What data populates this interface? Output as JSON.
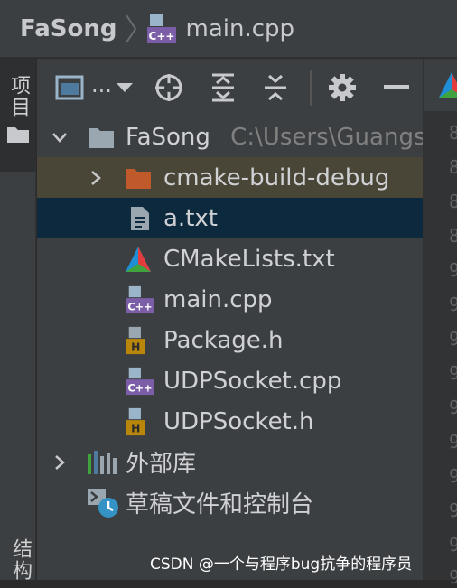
{
  "breadcrumb": {
    "project": "FaSong",
    "file": "main.cpp"
  },
  "sidebar": {
    "project_tab": "项目",
    "structure_tab": "结构"
  },
  "toolbar": {
    "view_label": "...",
    "icons": [
      "panel-view-icon",
      "dropdown-arrow-icon",
      "locate-icon",
      "expand-all-icon",
      "collapse-all-icon",
      "gear-icon",
      "minimize-icon"
    ]
  },
  "tree": {
    "root": {
      "name": "FaSong",
      "path": "C:\\Users\\Guangs"
    },
    "items": [
      {
        "label": "cmake-build-debug",
        "icon": "folder-orange-icon"
      },
      {
        "label": "a.txt",
        "icon": "text-file-icon"
      },
      {
        "label": "CMakeLists.txt",
        "icon": "cmake-icon"
      },
      {
        "label": "main.cpp",
        "icon": "cpp-file-icon"
      },
      {
        "label": "Package.h",
        "icon": "header-file-icon"
      },
      {
        "label": "UDPSocket.cpp",
        "icon": "cpp-file-icon"
      },
      {
        "label": "UDPSocket.h",
        "icon": "header-file-icon"
      }
    ],
    "external_libs": "外部库",
    "scratches": "草稿文件和控制台"
  },
  "editor": {
    "line_digits": [
      "8",
      "8",
      "8",
      "8",
      "9",
      "9",
      "9",
      "9",
      "9",
      "9",
      "9",
      "9",
      "9",
      "9"
    ]
  },
  "watermark": "CSDN @一个与程序bug抗争的程序员",
  "colors": {
    "selection": "#0d293e",
    "folder_highlight": "#4a4637",
    "cpp_badge": "#7b5ea7",
    "header_badge": "#b8860b"
  }
}
